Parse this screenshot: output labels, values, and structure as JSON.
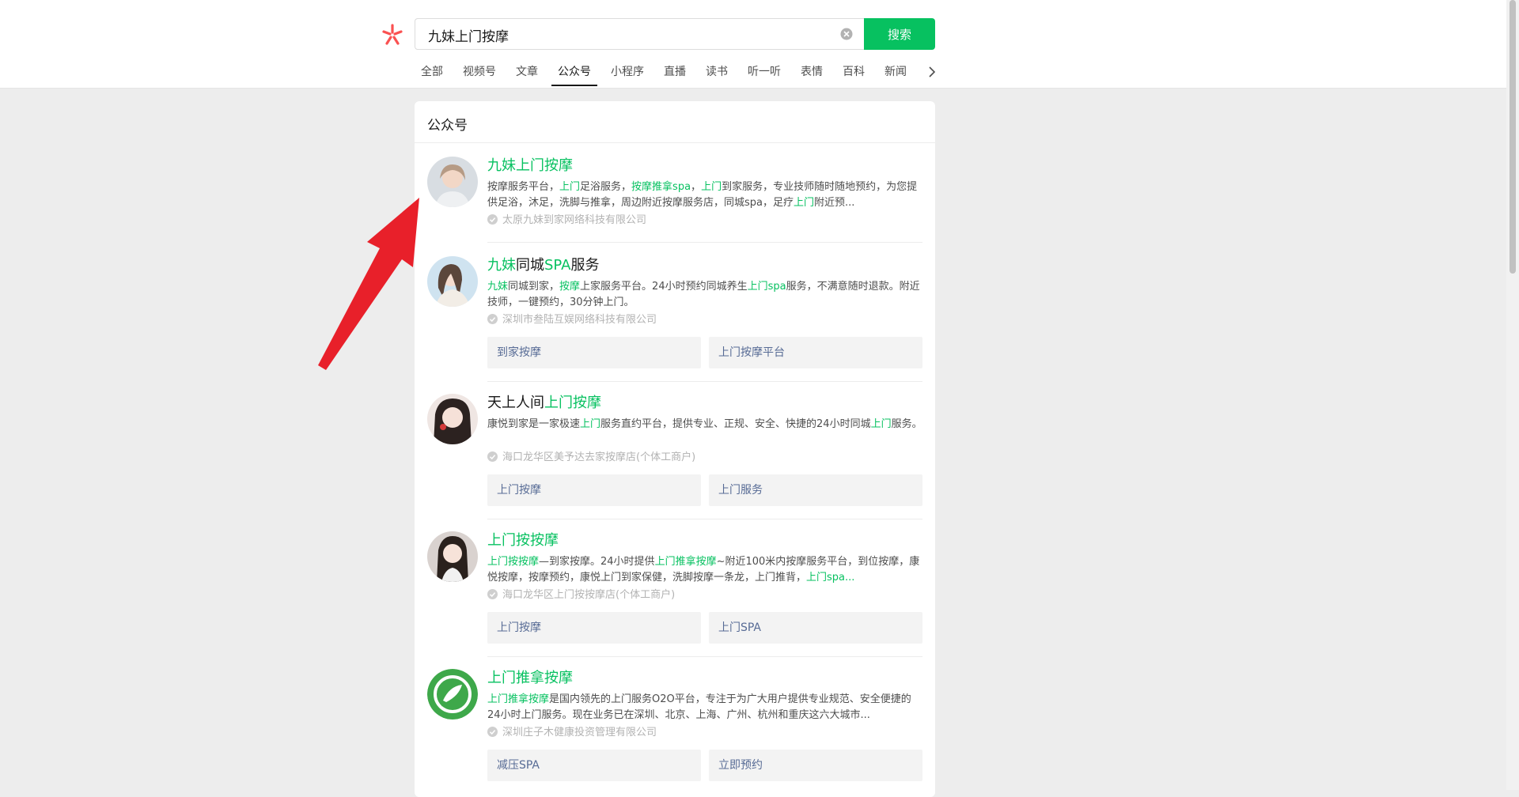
{
  "search": {
    "query": "九妹上门按摩",
    "button_label": "搜索"
  },
  "tabs": [
    "全部",
    "视频号",
    "文章",
    "公众号",
    "小程序",
    "直播",
    "读书",
    "听一听",
    "表情",
    "百科",
    "新闻"
  ],
  "active_tab": "公众号",
  "section_title": "公众号",
  "results": [
    {
      "title": [
        {
          "t": "九妹上门按摩",
          "h": true
        }
      ],
      "desc": [
        {
          "t": "按摩服务平台，",
          "h": false
        },
        {
          "t": "上门",
          "h": true
        },
        {
          "t": "足浴服务，",
          "h": false
        },
        {
          "t": "按摩推拿spa",
          "h": true
        },
        {
          "t": "，",
          "h": false
        },
        {
          "t": "上门",
          "h": true
        },
        {
          "t": "到家服务，专业技师随时随地预约，为您提供足浴，沐足，洗脚与推拿，周边附近按摩服务店，同城spa，足疗",
          "h": false
        },
        {
          "t": "上门",
          "h": true
        },
        {
          "t": "附近预...",
          "h": false
        }
      ],
      "owner": "太原九妹到家网络科技有限公司",
      "chips": []
    },
    {
      "title": [
        {
          "t": "九妹",
          "h": true
        },
        {
          "t": "同城",
          "h": false
        },
        {
          "t": "SPA",
          "h": true
        },
        {
          "t": "服务",
          "h": false
        }
      ],
      "desc": [
        {
          "t": "九妹",
          "h": true
        },
        {
          "t": "同城到家，",
          "h": false
        },
        {
          "t": "按摩",
          "h": true
        },
        {
          "t": "上家服务平台。24小时预约同城养生",
          "h": false
        },
        {
          "t": "上门spa",
          "h": true
        },
        {
          "t": "服务，不满意随时退款。附近技师，一键预约，30分钟上门。",
          "h": false
        }
      ],
      "owner": "深圳市叁陆互娱网络科技有限公司",
      "chips": [
        "到家按摩",
        "上门按摩平台"
      ]
    },
    {
      "title": [
        {
          "t": "天上人间",
          "h": false
        },
        {
          "t": "上门按摩",
          "h": true
        }
      ],
      "desc": [
        {
          "t": "康悦到家是一家极速",
          "h": false
        },
        {
          "t": "上门",
          "h": true
        },
        {
          "t": "服务直约平台，提供专业、正规、安全、快捷的24小时同城",
          "h": false
        },
        {
          "t": "上门",
          "h": true
        },
        {
          "t": "服务。",
          "h": false
        }
      ],
      "owner": "海口龙华区美予达去家按摩店(个体工商户)",
      "chips": [
        "上门按摩",
        "上门服务"
      ]
    },
    {
      "title": [
        {
          "t": "上门按按摩",
          "h": true
        }
      ],
      "desc": [
        {
          "t": "上门按按摩",
          "h": true
        },
        {
          "t": "—到家按摩。24小时提供",
          "h": false
        },
        {
          "t": "上门推拿按摩",
          "h": true
        },
        {
          "t": "~附近100米内按摩服务平台，到位按摩，康悦按摩，按摩预约，康悦上门到家保健，洗脚按摩一条龙，上门推背，",
          "h": false
        },
        {
          "t": "上门spa...",
          "h": true
        }
      ],
      "owner": "海口龙华区上门按按摩店(个体工商户)",
      "chips": [
        "上门按摩",
        "上门SPA"
      ]
    },
    {
      "title": [
        {
          "t": "上门推拿按摩",
          "h": true
        }
      ],
      "desc": [
        {
          "t": "上门推拿按摩",
          "h": true
        },
        {
          "t": "是国内领先的上门服务O2O平台，专注于为广大用户提供专业规范、安全便捷的24小时上门服务。现在业务已在深圳、北京、上海、广州、杭州和重庆这六大城市...",
          "h": false
        }
      ],
      "owner": "深圳庄子木健康投资管理有限公司",
      "chips": [
        "减压SPA",
        "立即预约"
      ]
    }
  ],
  "colors": {
    "brand_green": "#07c160",
    "link_blue": "#576b95",
    "annotation_red": "#e8202a"
  }
}
